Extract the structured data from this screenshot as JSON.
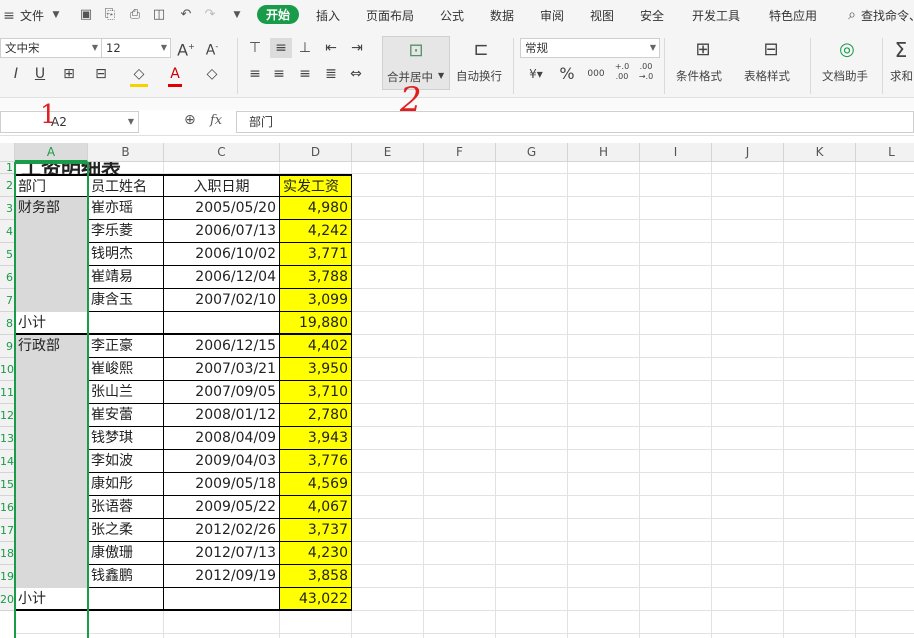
{
  "menubar": {
    "file": "文件",
    "tabs": [
      "开始",
      "插入",
      "页面布局",
      "公式",
      "数据",
      "审阅",
      "视图",
      "安全",
      "开发工具",
      "特色应用"
    ],
    "search": "查找命令、"
  },
  "ribbon": {
    "font_name": "文中宋",
    "font_size": "12",
    "number_format": "常规",
    "merge_label": "合并居中",
    "wrap_label": "自动换行",
    "cond_format_label": "条件格式",
    "table_style_label": "表格样式",
    "doc_helper_label": "文档助手",
    "sum_label": "求和",
    "percent": "%",
    "thousands": "000",
    "inc_decimal": "+.0 .00",
    "dec_decimal": ".00 →.0"
  },
  "formula_bar": {
    "name_box": "A2",
    "fx": "fx",
    "content": "部门"
  },
  "annotations": {
    "one": "1",
    "two": "2"
  },
  "columns": [
    "A",
    "B",
    "C",
    "D",
    "E",
    "F",
    "G",
    "H",
    "I",
    "J",
    "K",
    "L"
  ],
  "row_numbers": [
    "1",
    "2",
    "3",
    "4",
    "5",
    "6",
    "7",
    "8",
    "9",
    "10",
    "11",
    "12",
    "13",
    "14",
    "15",
    "16",
    "17",
    "18",
    "19",
    "20"
  ],
  "table": {
    "title": "工资明细表",
    "headers": [
      "部门",
      "员工姓名",
      "入职日期",
      "实发工资"
    ],
    "rows": [
      [
        "财务部",
        "崔亦瑶",
        "2005/05/20",
        "4,980"
      ],
      [
        "",
        "李乐菱",
        "2006/07/13",
        "4,242"
      ],
      [
        "",
        "钱明杰",
        "2006/10/02",
        "3,771"
      ],
      [
        "",
        "崔靖易",
        "2006/12/04",
        "3,788"
      ],
      [
        "",
        "康含玉",
        "2007/02/10",
        "3,099"
      ],
      [
        "小计",
        "",
        "",
        "19,880"
      ],
      [
        "行政部",
        "李正豪",
        "2006/12/15",
        "4,402"
      ],
      [
        "",
        "崔峻熙",
        "2007/03/21",
        "3,950"
      ],
      [
        "",
        "张山兰",
        "2007/09/05",
        "3,710"
      ],
      [
        "",
        "崔安蕾",
        "2008/01/12",
        "2,780"
      ],
      [
        "",
        "钱梦琪",
        "2008/04/09",
        "3,943"
      ],
      [
        "",
        "李如波",
        "2009/04/03",
        "3,776"
      ],
      [
        "",
        "康如彤",
        "2009/05/18",
        "4,569"
      ],
      [
        "",
        "张语蓉",
        "2009/05/22",
        "4,067"
      ],
      [
        "",
        "张之柔",
        "2012/02/26",
        "3,737"
      ],
      [
        "",
        "康傲珊",
        "2012/07/13",
        "4,230"
      ],
      [
        "",
        "钱鑫鹏",
        "2012/09/19",
        "3,858"
      ],
      [
        "小计",
        "",
        "",
        "43,022"
      ]
    ]
  }
}
